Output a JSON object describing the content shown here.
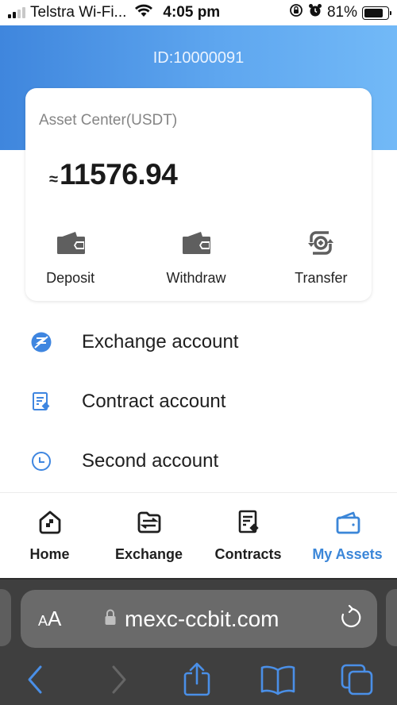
{
  "status_bar": {
    "carrier": "Telstra Wi-Fi...",
    "time": "4:05 pm",
    "battery_percent": "81%",
    "battery_level": 0.81,
    "signal_bars_active": 2,
    "signal_bars_total": 4,
    "icons": [
      "signal-icon",
      "wifi-icon",
      "orientation-lock-icon",
      "alarm-icon",
      "battery-icon"
    ]
  },
  "header": {
    "user_id": "ID:10000091"
  },
  "asset_card": {
    "title": "Asset Center(USDT)",
    "approx_symbol": "≈",
    "balance": "11576.94",
    "actions": [
      {
        "label": "Deposit",
        "icon": "wallet-in-icon"
      },
      {
        "label": "Withdraw",
        "icon": "wallet-out-icon"
      },
      {
        "label": "Transfer",
        "icon": "transfer-icon"
      }
    ]
  },
  "accounts": [
    {
      "label": "Exchange account",
      "icon": "exchange-icon"
    },
    {
      "label": "Contract account",
      "icon": "contract-icon"
    },
    {
      "label": "Second account",
      "icon": "clock-icon"
    }
  ],
  "tabbar": {
    "tabs": [
      {
        "label": "Home",
        "icon": "home-icon",
        "active": false
      },
      {
        "label": "Exchange",
        "icon": "exchange-folder-icon",
        "active": false
      },
      {
        "label": "Contracts",
        "icon": "contract-icon",
        "active": false
      },
      {
        "label": "My Assets",
        "icon": "wallet-icon",
        "active": true
      }
    ]
  },
  "browser": {
    "text_size_label_small": "A",
    "text_size_label_large": "A",
    "url": "mexc-ccbit.com",
    "icons": [
      "lock-icon",
      "reload-icon",
      "back-icon",
      "forward-icon",
      "share-icon",
      "bookmarks-icon",
      "tabs-icon"
    ]
  },
  "colors": {
    "accent": "#3b86d8",
    "header_gradient_start": "#3f86dd",
    "header_gradient_end": "#72b9f7",
    "safari_toolbar": "#3f3f3f",
    "safari_urlbar": "#6a6a6a",
    "safari_accent": "#4a8fe7"
  }
}
